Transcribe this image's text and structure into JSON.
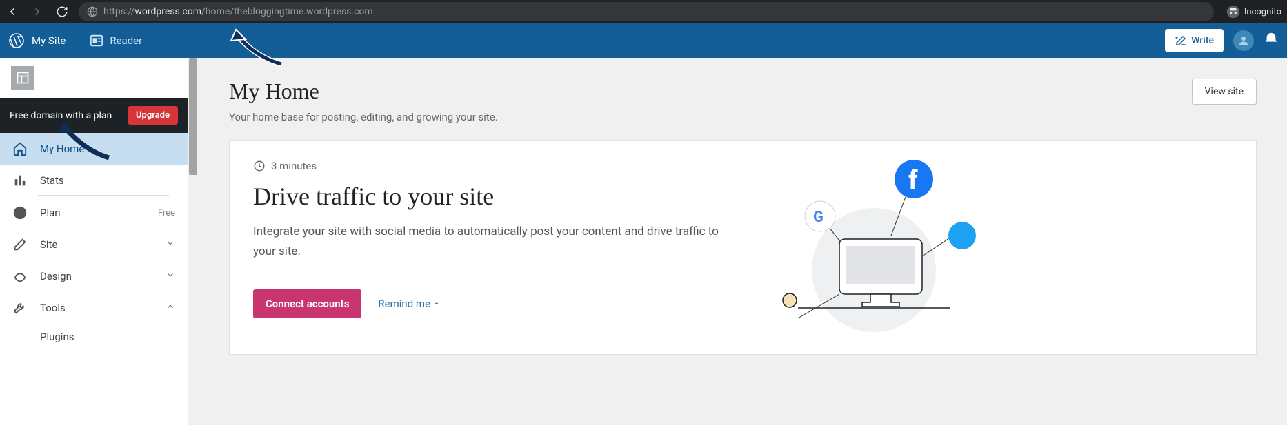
{
  "browser": {
    "url_prefix": "https://",
    "url_domain": "wordpress.com",
    "url_path": "/home/thebloggingtime.wordpress.com",
    "incognito_label": "Incognito"
  },
  "topbar": {
    "my_site_label": "My Site",
    "reader_label": "Reader",
    "write_label": "Write"
  },
  "sidebar": {
    "free_domain_label": "Free domain with a plan",
    "upgrade_label": "Upgrade",
    "items": [
      {
        "label": "My Home"
      },
      {
        "label": "Stats"
      },
      {
        "label": "Plan",
        "meta": "Free"
      },
      {
        "label": "Site"
      },
      {
        "label": "Design"
      },
      {
        "label": "Tools"
      }
    ],
    "sub_item_label": "Plugins"
  },
  "main": {
    "page_title": "My Home",
    "page_sub": "Your home base for posting, editing, and growing your site.",
    "view_site_label": "View site",
    "card": {
      "minutes": "3 minutes",
      "title": "Drive traffic to your site",
      "desc": "Integrate your site with social media to automatically post your content and drive traffic to your site.",
      "connect_label": "Connect accounts",
      "remind_label": "Remind me"
    }
  }
}
